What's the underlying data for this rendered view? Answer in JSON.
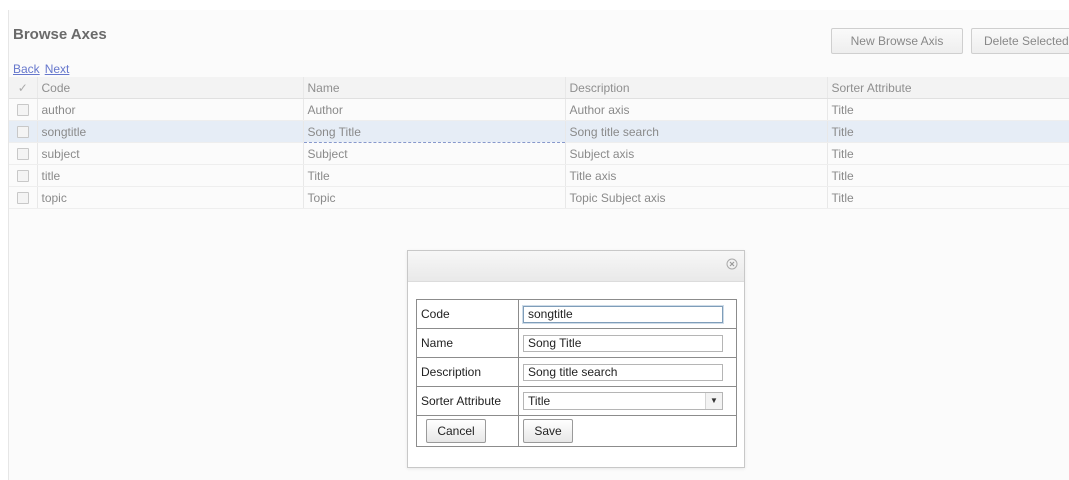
{
  "header": {
    "title": "Browse Axes",
    "new_button": "New Browse Axis",
    "delete_button": "Delete Selected"
  },
  "nav": {
    "back": "Back",
    "next": "Next"
  },
  "table": {
    "check_header": "✓",
    "columns": [
      "Code",
      "Name",
      "Description",
      "Sorter Attribute"
    ],
    "rows": [
      {
        "code": "author",
        "name": "Author",
        "description": "Author axis",
        "sorter": "Title"
      },
      {
        "code": "songtitle",
        "name": "Song Title",
        "description": "Song title search",
        "sorter": "Title"
      },
      {
        "code": "subject",
        "name": "Subject",
        "description": "Subject axis",
        "sorter": "Title"
      },
      {
        "code": "title",
        "name": "Title",
        "description": "Title axis",
        "sorter": "Title"
      },
      {
        "code": "topic",
        "name": "Topic",
        "description": "Topic Subject axis",
        "sorter": "Title"
      }
    ]
  },
  "dialog": {
    "labels": {
      "code": "Code",
      "name": "Name",
      "description": "Description",
      "sorter": "Sorter Attribute"
    },
    "values": {
      "code": "songtitle",
      "name": "Song Title",
      "description": "Song title search",
      "sorter": "Title"
    },
    "cancel": "Cancel",
    "save": "Save"
  },
  "colors": {
    "link": "#6677cc",
    "selected_row": "#e6edf6"
  },
  "icons": {
    "close": "close-icon",
    "dropdown": "chevron-down-icon"
  }
}
